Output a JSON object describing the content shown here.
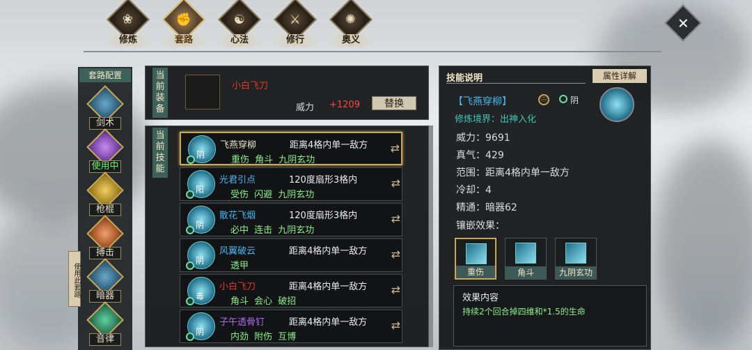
{
  "nav": {
    "tabs": [
      {
        "label": "修炼",
        "icon": "lotus-flame-icon"
      },
      {
        "label": "套路",
        "icon": "fist-icon"
      },
      {
        "label": "心法",
        "icon": "swirl-icon"
      },
      {
        "label": "修行",
        "icon": "crossed-blades-icon"
      },
      {
        "label": "奥义",
        "icon": "flame-emblem-icon"
      }
    ],
    "active": 1
  },
  "sidebar": {
    "header": "套路配置",
    "use_this_routine": "使用此套路",
    "weapons": [
      {
        "label": "剑术",
        "icon": "sword-icon"
      },
      {
        "label": "使用中",
        "icon": "purple-palm-icon",
        "current": true
      },
      {
        "label": "枪棍",
        "icon": "golden-fist-icon"
      },
      {
        "label": "搏击",
        "icon": "red-fist-icon"
      },
      {
        "label": "暗器",
        "icon": "dart-icon"
      },
      {
        "label": "音律",
        "icon": "zither-icon"
      }
    ]
  },
  "equipment": {
    "section_label": "当前装备",
    "item_name": "小白飞刀",
    "power_label": "威力",
    "power_value": "+1209",
    "swap_label": "替换",
    "item_color": "#e03a2a"
  },
  "skills": {
    "section_label": "当前技能",
    "rows": [
      {
        "name": "飞燕穿柳",
        "range": "距离4格内单一敌方",
        "tags": "重伤 角斗 九阴玄功",
        "attr": "阴",
        "name_color": "#eae2c6",
        "selected": true
      },
      {
        "name": "光君引点",
        "range": "120度扇形3格内",
        "tags": "受伤 闪避 九阴玄功",
        "attr": "阳",
        "name_color": "#4ab6f0",
        "selected": false
      },
      {
        "name": "散花飞烟",
        "range": "120度扇形3格内",
        "tags": "必中 连击 九阴玄功",
        "attr": "阴",
        "name_color": "#4ab6f0",
        "selected": false
      },
      {
        "name": "风翼破云",
        "range": "距离4格内单一敌方",
        "tags": "透甲",
        "attr": "阴",
        "name_color": "#4ab6f0",
        "selected": false
      },
      {
        "name": "小白飞刀",
        "range": "距离4格内单一敌方",
        "tags": "角斗 会心 破招",
        "attr": "毒",
        "name_color": "#e03a2a",
        "selected": false
      },
      {
        "name": "子午透骨钉",
        "range": "距离4格内单一敌方",
        "tags": "内劲 附伤 互博",
        "attr": "阴",
        "name_color": "#b06cf0",
        "selected": false
      }
    ]
  },
  "detail": {
    "header": "技能说明",
    "attr_button": "属性详解",
    "skill_name": "【飞燕穿柳】",
    "mark": "㊁",
    "tag": "阴",
    "realm": "修炼境界：出神入化",
    "stats": [
      {
        "label": "威力：",
        "value": "9691"
      },
      {
        "label": "真气：",
        "value": "429"
      },
      {
        "label": "范围：",
        "value": "距离4格内单一敌方"
      },
      {
        "label": "冷却：",
        "value": "4"
      },
      {
        "label": "精通：",
        "value": "暗器62"
      }
    ],
    "inlay_title": "镶嵌效果：",
    "inlays": [
      {
        "label": "重伤",
        "icon": "slash-icon",
        "selected": true
      },
      {
        "label": "角斗",
        "icon": "burst-icon",
        "selected": false
      },
      {
        "label": "九阴玄功",
        "icon": "book-icon",
        "selected": false
      }
    ],
    "effect_title": "效果内容",
    "effect_desc": "持续2个回合掉四维和*1.5的生命"
  }
}
